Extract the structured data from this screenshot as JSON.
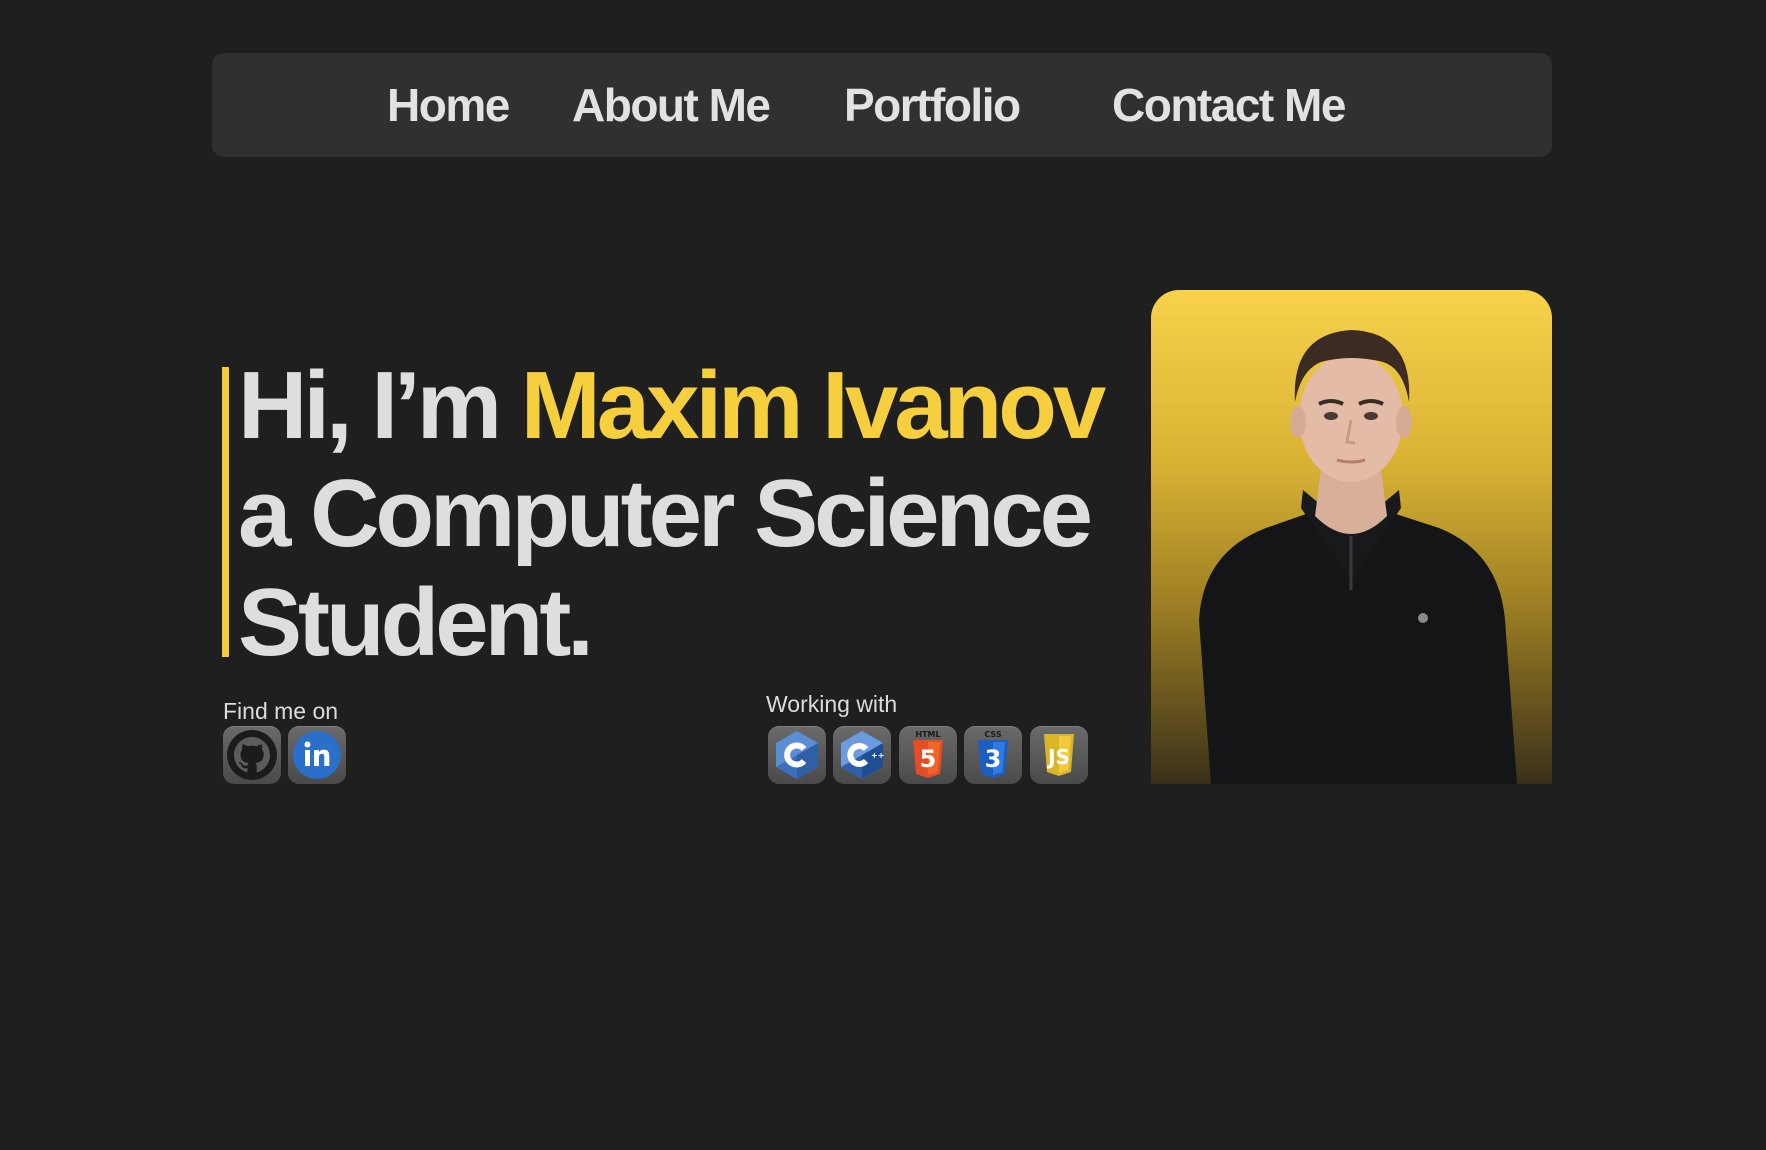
{
  "nav": {
    "home": "Home",
    "about": "About Me",
    "portfolio": "Portfolio",
    "contact": "Contact Me"
  },
  "hero": {
    "greeting": "Hi, I’m ",
    "name": "Maxim Ivanov",
    "line2": "a Computer Science",
    "line3": "Student."
  },
  "social": {
    "label": "Find me on",
    "icons": [
      "github-icon",
      "linkedin-icon"
    ]
  },
  "skills": {
    "label": "Working with",
    "icons": [
      "c-icon",
      "cpp-icon",
      "html5-icon",
      "css3-icon",
      "javascript-icon"
    ],
    "html_badge": "HTML",
    "html_number": "5",
    "css_badge": "CSS",
    "css_number": "3",
    "js_letters": "JS"
  },
  "colors": {
    "background": "#1f1f1f",
    "navbar": "#2f302f",
    "accent": "#f6cf3f",
    "text": "#dedede"
  }
}
